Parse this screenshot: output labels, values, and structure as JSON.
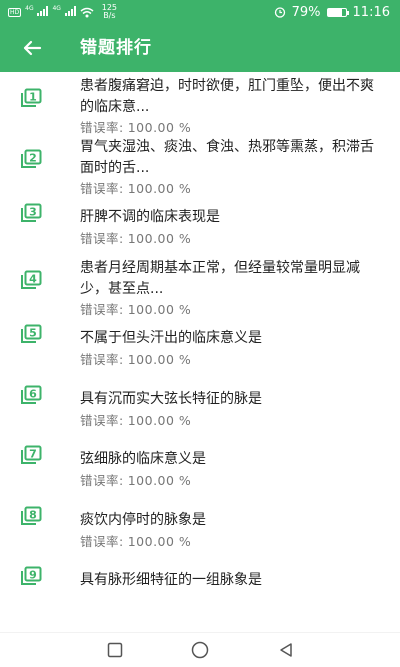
{
  "status_bar": {
    "net_tag": "HD",
    "net1": "4G",
    "net2": "4G",
    "speed_value": "125",
    "speed_unit": "B/s",
    "battery": "79%",
    "battery_level": 0.79,
    "time": "11:16"
  },
  "header": {
    "title": "错题排行"
  },
  "items": [
    {
      "rank": "1",
      "question": "患者腹痛窘迫，时时欲便，肛门重坠，便出不爽的临床意...",
      "error_label": "错误率:",
      "error_value": "100.00 %"
    },
    {
      "rank": "2",
      "question": "胃气夹湿浊、痰浊、食浊、热邪等熏蒸，积滞舌面时的舌...",
      "error_label": "错误率:",
      "error_value": "100.00 %"
    },
    {
      "rank": "3",
      "question": "肝脾不调的临床表现是",
      "error_label": "错误率:",
      "error_value": "100.00 %"
    },
    {
      "rank": "4",
      "question": "患者月经周期基本正常，但经量较常量明显减少，甚至点...",
      "error_label": "错误率:",
      "error_value": "100.00 %"
    },
    {
      "rank": "5",
      "question": "不属于但头汗出的临床意义是",
      "error_label": "错误率:",
      "error_value": "100.00 %"
    },
    {
      "rank": "6",
      "question": "具有沉而实大弦长特征的脉是",
      "error_label": "错误率:",
      "error_value": "100.00 %"
    },
    {
      "rank": "7",
      "question": "弦细脉的临床意义是",
      "error_label": "错误率:",
      "error_value": "100.00 %"
    },
    {
      "rank": "8",
      "question": "痰饮内停时的脉象是",
      "error_label": "错误率:",
      "error_value": "100.00 %"
    },
    {
      "rank": "9",
      "question": "具有脉形细特征的一组脉象是",
      "error_label": "",
      "error_value": ""
    }
  ],
  "icons": {
    "back": "arrow-left-icon",
    "rank": "stacked-square-number-icon",
    "nav_recent": "square-icon",
    "nav_home": "circle-icon",
    "nav_back": "triangle-left-icon"
  },
  "colors": {
    "primary": "#3db36a",
    "icon_green": "#3db36a",
    "text": "#222222",
    "subtext": "#777777"
  }
}
